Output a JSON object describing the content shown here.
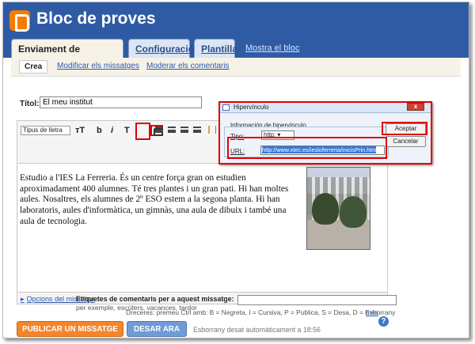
{
  "window": {
    "title": "Bloc de proves"
  },
  "tabs": [
    {
      "label": "Enviament de missatges"
    },
    {
      "label": "Configuració"
    },
    {
      "label": "Plantilla"
    }
  ],
  "view_blog": "Mostra el bloc",
  "subnav": [
    {
      "label": "Crea"
    },
    {
      "label": "Modificar els missatges"
    },
    {
      "label": "Moderar els comentaris"
    }
  ],
  "post": {
    "title_label": "Títol:",
    "title_value": "El meu institut",
    "content": "Estudio a l'IES La Ferreria. És un centre força gran on estudien aproximadament 400 alumnes. Té tres plantes i un gran pati. Hi han moltes aules. Nosaltres, els alumnes de 2º ESO estem a la segona planta. Hi han laboratoris, aules d'informàtica, un gimnàs, una aula de dibuix i també una aula de tecnologia."
  },
  "toolbar": {
    "font_type": "Tipus de lletra",
    "size": "тT",
    "bold": "b",
    "italic": "i",
    "color": "T",
    "icons": [
      "link-icon",
      "align-left-icon",
      "align-center-icon",
      "align-right-icon",
      "align-justify-icon",
      "list-icon"
    ]
  },
  "bottom": {
    "post_options": "Opcions del missatge",
    "labels_title": "Etiquetes de comentaris per a aquest missatge:",
    "labels_example": "per exemple, escúters, vacances, tardor",
    "shortcuts": "Dreceres: premeu Ctrl amb: B = Negreta, I = Cursiva, P = Publica, S = Desa, D = Esborrany",
    "more": "més",
    "publish": "PUBLICAR UN MISSATGE",
    "save": "DESAR ARA",
    "draft_status": "Esborrany desat automàticament a 18:56"
  },
  "dialog": {
    "title": "Hipervínculo",
    "group_label": "Información de hipervínculo",
    "type_label": "Tipo:",
    "type_value": "http:",
    "url_label": "URL:",
    "url_value": "http://www.xtec.es/iesloferreria/inicisPrin.htm",
    "ok": "Aceptar",
    "cancel": "Cancelar",
    "close": "x"
  },
  "colors": {
    "header": "#2f5ba5",
    "accent": "#f5842a",
    "save": "#6f9bd6",
    "highlight": "#e00000"
  }
}
